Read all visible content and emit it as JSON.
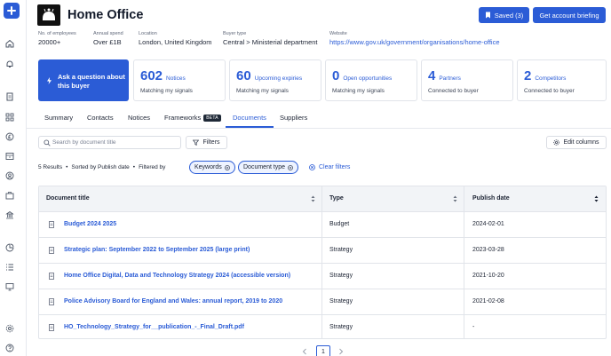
{
  "buyer": {
    "title": "Home Office"
  },
  "header": {
    "saved_label": "Saved (3)",
    "briefing_label": "Get account briefing"
  },
  "meta": [
    {
      "key": "No. of employees",
      "value": "20000+"
    },
    {
      "key": "Annual spend",
      "value": "Over £1B"
    },
    {
      "key": "Location",
      "value": "London, United Kingdom"
    },
    {
      "key": "Buyer type",
      "value": "Central > Ministerial department"
    },
    {
      "key": "Website",
      "value": "https://www.gov.uk/government/organisations/home-office"
    }
  ],
  "ask_card": {
    "label": "Ask a question about this buyer"
  },
  "stats": [
    {
      "count": "602",
      "label": "Notices",
      "sub": "Matching my signals"
    },
    {
      "count": "60",
      "label": "Upcoming expiries",
      "sub": "Matching my signals"
    },
    {
      "count": "0",
      "label": "Open opportunities",
      "sub": "Matching my signals"
    },
    {
      "count": "4",
      "label": "Partners",
      "sub": "Connected to buyer"
    },
    {
      "count": "2",
      "label": "Competitors",
      "sub": "Connected to buyer"
    }
  ],
  "tabs": [
    "Summary",
    "Contacts",
    "Notices",
    "Frameworks",
    "Documents",
    "Suppliers"
  ],
  "beta_label": "BETA",
  "active_tab": "Documents",
  "toolbar": {
    "search_placeholder": "Search by document title",
    "filters_label": "Filters",
    "edit_columns_label": "Edit columns"
  },
  "results": {
    "count_text": "5 Results",
    "sort_text": "Sorted by Publish date",
    "filtered_text": "Filtered by",
    "chips": [
      "Keywords",
      "Document type"
    ],
    "clear_label": "Clear filters"
  },
  "table": {
    "headers": {
      "title": "Document title",
      "type": "Type",
      "date": "Publish date"
    },
    "rows": [
      {
        "title": "Budget 2024 2025",
        "type": "Budget",
        "date": "2024-02-01"
      },
      {
        "title": "Strategic plan: September 2022 to September 2025 (large print)",
        "type": "Strategy",
        "date": "2023-03-28"
      },
      {
        "title": "Home Office Digital, Data and Technology Strategy 2024 (accessible version)",
        "type": "Strategy",
        "date": "2021-10-20"
      },
      {
        "title": "Police Advisory Board for England and Wales: annual report, 2019 to 2020",
        "type": "Strategy",
        "date": "2021-02-08"
      },
      {
        "title": "HO_Technology_Strategy_for__publication_-_Final_Draft.pdf",
        "type": "Strategy",
        "date": "-"
      }
    ]
  },
  "pagination": {
    "current_page": "1"
  },
  "icons": {
    "rail": [
      "home-icon",
      "bell-icon",
      "notices-icon",
      "grid-icon",
      "pound-icon",
      "inbox-icon",
      "target-icon",
      "briefcase-icon",
      "building-icon",
      "chart-icon",
      "list-icon",
      "monitor-icon",
      "settings-icon",
      "help-icon"
    ]
  },
  "colors": {
    "accent": "#2b5cd6",
    "header_bg": "#f2f4f7",
    "chip_bg": "#eef3ff"
  }
}
